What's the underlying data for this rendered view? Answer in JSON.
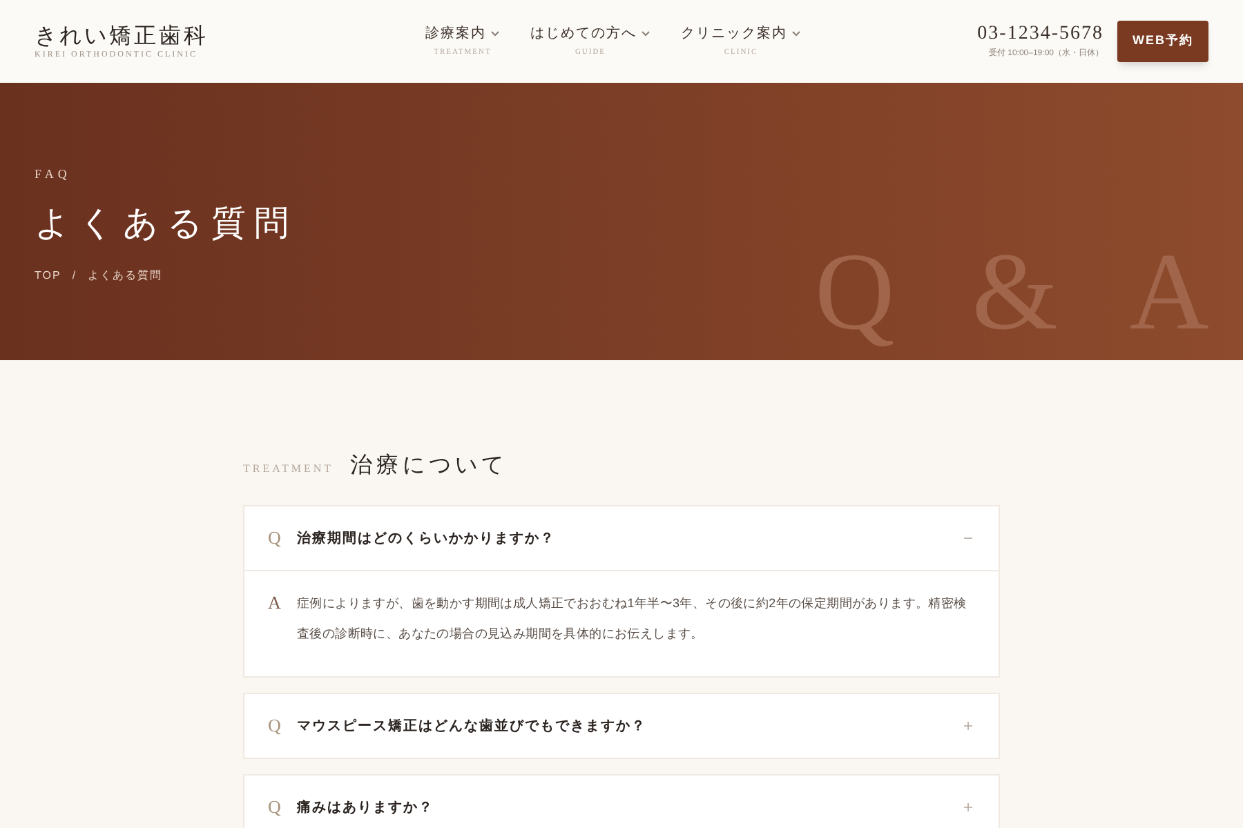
{
  "header": {
    "logo": "きれい矯正歯科",
    "logo_sub": "KIREI ORTHODONTIC CLINIC",
    "nav": [
      {
        "label": "診療案内",
        "sub": "TREATMENT"
      },
      {
        "label": "はじめての方へ",
        "sub": "GUIDE"
      },
      {
        "label": "クリニック案内",
        "sub": "CLINIC"
      }
    ],
    "phone": "03-1234-5678",
    "hours": "受付 10:00–19:00（水・日休）",
    "cta": "WEB予約"
  },
  "hero": {
    "eyebrow": "FAQ",
    "title": "よくある質問",
    "breadcrumb": [
      "TOP",
      "よくある質問"
    ],
    "separator": "/",
    "backdrop_text": "Q & A"
  },
  "section": {
    "eyebrow": "TREATMENT",
    "title": "治療について",
    "faqs": [
      {
        "q_mark": "Q",
        "question": "治療期間はどのくらいかかりますか？",
        "expanded": true,
        "a_mark": "A",
        "answer": "症例によりますが、歯を動かす期間は成人矯正でおおむね1年半〜3年、その後に約2年の保定期間があります。精密検査後の診断時に、あなたの場合の見込み期間を具体的にお伝えします。"
      },
      {
        "q_mark": "Q",
        "question": "マウスピース矯正はどんな歯並びでもできますか？",
        "expanded": false
      },
      {
        "q_mark": "Q",
        "question": "痛みはありますか？",
        "expanded": false
      }
    ]
  }
}
